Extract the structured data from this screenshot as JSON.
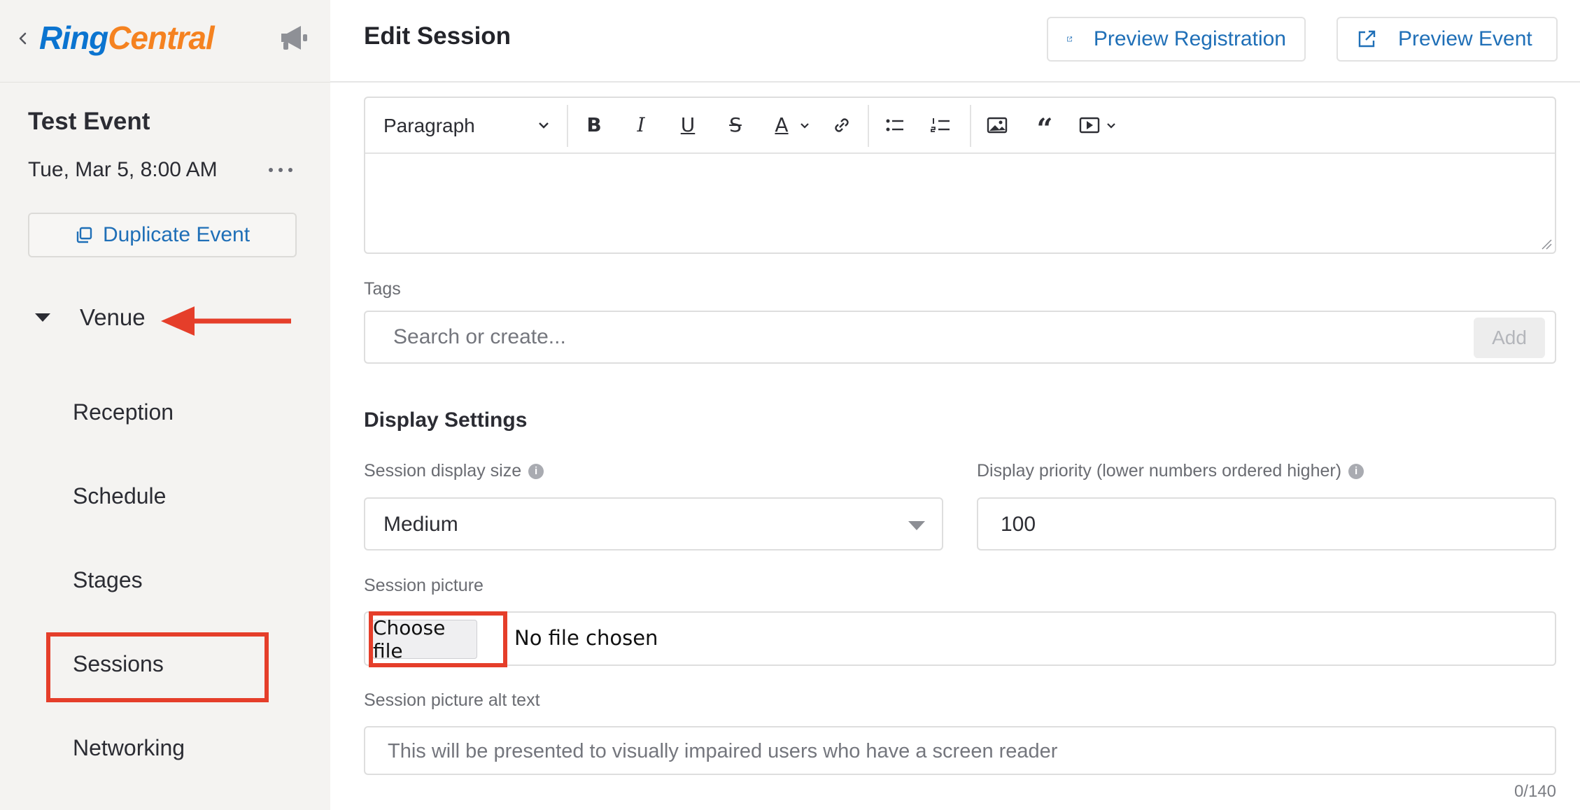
{
  "brand": {
    "logo_ring": "Ring",
    "logo_central": "Central",
    "ring_color": "#0b74d0",
    "central_color": "#f58220"
  },
  "sidebar": {
    "event_title": "Test Event",
    "event_date": "Tue, Mar 5, 8:00 AM",
    "duplicate_label": "Duplicate Event",
    "venue_label": "Venue",
    "nav_items": [
      {
        "label": "Reception"
      },
      {
        "label": "Schedule"
      },
      {
        "label": "Stages"
      },
      {
        "label": "Sessions"
      },
      {
        "label": "Networking"
      }
    ]
  },
  "header": {
    "title": "Edit Session",
    "preview_registration": "Preview Registration",
    "preview_event": "Preview Event"
  },
  "editor": {
    "paragraph_style": "Paragraph",
    "content": ""
  },
  "tags": {
    "label": "Tags",
    "placeholder": "Search or create...",
    "add_label": "Add"
  },
  "display_settings": {
    "title": "Display Settings",
    "display_size_label": "Session display size",
    "display_size_value": "Medium",
    "priority_label": "Display priority (lower numbers ordered higher)",
    "priority_value": "100",
    "picture_label": "Session picture",
    "choose_file_label": "Choose file",
    "no_file_text": "No file chosen",
    "alt_label": "Session picture alt text",
    "alt_placeholder": "This will be presented to visually impaired users who have a screen reader",
    "alt_counter": "0/140"
  },
  "annotations": {
    "highlight_color": "#e53e2a"
  }
}
